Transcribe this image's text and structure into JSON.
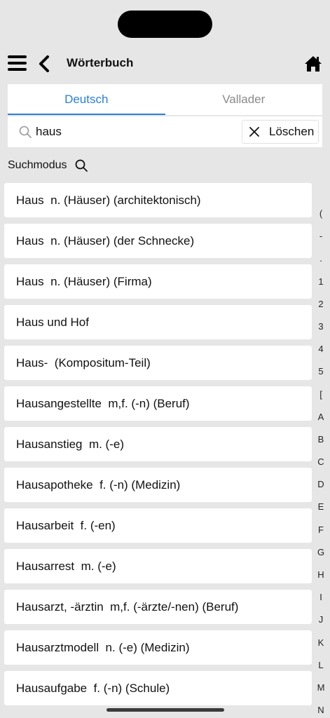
{
  "header": {
    "title": "Wörterbuch"
  },
  "tabs": [
    {
      "label": "Deutsch",
      "active": true
    },
    {
      "label": "Vallader",
      "active": false
    }
  ],
  "search": {
    "value": "haus",
    "clear_label": "Löschen"
  },
  "mode": {
    "label": "Suchmodus"
  },
  "results": [
    "Haus  n. (Häuser) (architektonisch)",
    "Haus  n. (Häuser) (der Schnecke)",
    "Haus  n. (Häuser) (Firma)",
    "Haus und Hof",
    "Haus-  (Kompositum-Teil)",
    "Hausangestellte  m,f. (-n) (Beruf)",
    "Hausanstieg  m. (-e)",
    "Hausapotheke  f. (-n) (Medizin)",
    "Hausarbeit  f. (-en)",
    "Hausarrest  m. (-e)",
    "Hausarzt, -ärztin  m,f. (-ärzte/-nen) (Beruf)",
    "Hausarztmodell  n. (-e) (Medizin)",
    "Hausaufgabe  f. (-n) (Schule)"
  ],
  "index": [
    "(",
    "-",
    ".",
    "1",
    "2",
    "3",
    "4",
    "5",
    "[",
    "A",
    "B",
    "C",
    "D",
    "E",
    "F",
    "G",
    "H",
    "I",
    "J",
    "K",
    "L",
    "M",
    "N"
  ],
  "colors": {
    "accent": "#2a7fd8",
    "background": "#e6e6e6"
  }
}
